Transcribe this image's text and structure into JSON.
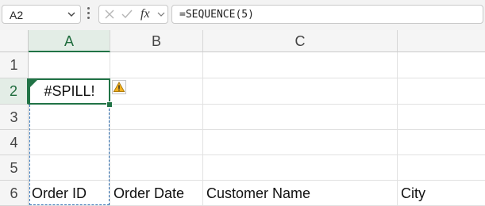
{
  "name_box": {
    "value": "A2"
  },
  "formula_bar": {
    "fx_label": "fx",
    "formula": "=SEQUENCE(5)"
  },
  "columns": [
    {
      "label": "A"
    },
    {
      "label": "B"
    },
    {
      "label": "C"
    }
  ],
  "rows": [
    "1",
    "2",
    "3",
    "4",
    "5",
    "6"
  ],
  "active_cell": {
    "ref": "A2",
    "value": "#SPILL!"
  },
  "row6": {
    "a": "Order ID",
    "b": "Order Date",
    "c": "Customer Name",
    "d": "City"
  },
  "icons": {
    "error_warning": "warning-icon",
    "name_box_dropdown": "chevron-down-icon",
    "cancel": "close-icon",
    "enter": "checkmark-icon",
    "insert_function": "fx-icon"
  },
  "colors": {
    "selection": "#217346",
    "spill_border": "#2b6cb0",
    "warning": "#e8a317"
  }
}
